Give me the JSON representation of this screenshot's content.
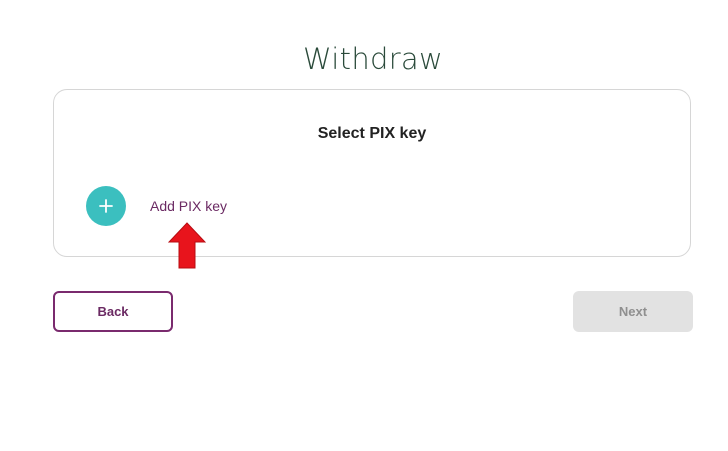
{
  "page": {
    "title": "Withdraw"
  },
  "card": {
    "title": "Select PIX key",
    "add_key_label": "Add PIX key",
    "add_icon": "plus-icon"
  },
  "annotation": {
    "icon": "red-arrow-up-icon",
    "color": "#e8141c"
  },
  "buttons": {
    "back_label": "Back",
    "next_label": "Next",
    "next_disabled": true
  },
  "colors": {
    "accent": "#3bbfbf",
    "brand": "#7a2a6e",
    "disabled_bg": "#e2e2e2"
  }
}
